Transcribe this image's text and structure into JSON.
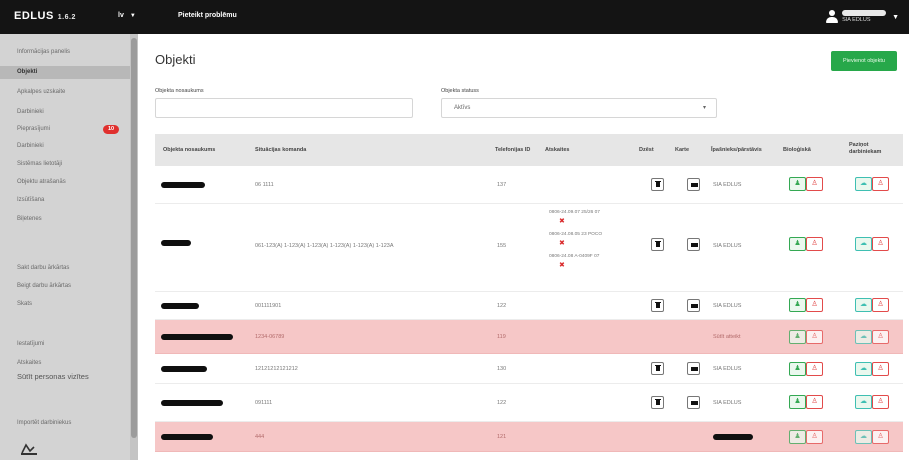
{
  "app": {
    "brand": "EDLUS",
    "version": "1.6.2",
    "language": "lv",
    "report_link": "Pieteikt problēmu"
  },
  "user": {
    "org": "SIA EDLUS"
  },
  "sidebar": {
    "items": [
      {
        "label": "Informācijas panelis",
        "active": false
      },
      {
        "label": "Objekti",
        "active": true
      },
      {
        "label": "Apkalpes uzskaite",
        "active": false
      },
      {
        "label": "Darbinieki",
        "active": false
      },
      {
        "label": "Pieprasījumi",
        "active": false,
        "badge": "10"
      },
      {
        "label": "Darbinieki",
        "active": false
      },
      {
        "label": "Sistēmas lietotāji",
        "active": false
      },
      {
        "label": "Objektu atrašanās",
        "active": false
      },
      {
        "label": "Izsūtīšana",
        "active": false
      },
      {
        "label": "Biļetenes",
        "active": false
      },
      {
        "label": "Sakt darbu ārkārtas",
        "active": false
      },
      {
        "label": "Beigt darbu ārkārtas",
        "active": false
      },
      {
        "label": "Skats",
        "active": false
      },
      {
        "label": "Iestatījumi",
        "active": false
      },
      {
        "label": "Atskaites",
        "active": false
      },
      {
        "label": "Sūtīt personas vizītes",
        "active": false
      },
      {
        "label": "Importēt darbiniekus",
        "active": false
      }
    ]
  },
  "page": {
    "title": "Objekti",
    "add_button": "Pievienot objektu",
    "filter_name_label": "Objekta nosaukums",
    "filter_status_label": "Objekta statuss",
    "filter_status_value": "Aktīvs"
  },
  "table": {
    "headers": {
      "name": "Objekta nosaukums",
      "command": "Situācijas komanda",
      "phone": "Telefonijas ID",
      "permissions": "Atskaites",
      "delete": "Dzēst",
      "map": "Karte",
      "owner": "Īpašnieks/pārstāvis",
      "protection": "Bioloģiskā",
      "notifications": "Paziņot darbiniekam"
    },
    "rows": [
      {
        "command": "06 1111",
        "phone": "137",
        "permissions": [],
        "owner": "SIA EDLUS",
        "alert": false,
        "show_actions": true
      },
      {
        "command": "061-123(A) 1-123(A) 1-123(A) 1-123(A) 1-123(A) 1-123A",
        "phone": "155",
        "permissions": [
          "0806-24.09.07 25/26 07",
          "0806-24.08.05 23 POCO",
          "0806-24.08 A-0409F 07"
        ],
        "owner": "SIA EDLUS",
        "alert": false,
        "show_actions": true
      },
      {
        "command": "001111901",
        "phone": "122",
        "permissions": [],
        "owner": "SIA EDLUS",
        "alert": false,
        "show_actions": true
      },
      {
        "command": "1234-06789",
        "phone": "119",
        "permissions": [],
        "owner": "Sūtīt atteikt",
        "alert": true,
        "show_actions": false
      },
      {
        "command": "12121212121212",
        "phone": "130",
        "permissions": [],
        "owner": "SIA EDLUS",
        "alert": false,
        "show_actions": true
      },
      {
        "command": "091111",
        "phone": "122",
        "permissions": [],
        "owner": "SIA EDLUS",
        "alert": false,
        "show_actions": true
      },
      {
        "command": "444",
        "phone": "121",
        "permissions": [],
        "owner": "",
        "alert": true,
        "show_actions": false
      }
    ]
  },
  "colors": {
    "topbar": "#141414",
    "accent_green": "#27a84a",
    "alert_row": "#f6c7c7",
    "badge_red": "#e0302e",
    "teal": "#3fbfb2"
  },
  "icons": {
    "user": "user-icon",
    "caret": "chevron-down-icon",
    "trash": "trash-icon",
    "map": "map-icon",
    "person": "person-icon",
    "person_remove": "person-remove-icon",
    "cloud": "cloud-icon",
    "permission_remove": "close-icon",
    "logo": "edlus-logo-icon"
  }
}
